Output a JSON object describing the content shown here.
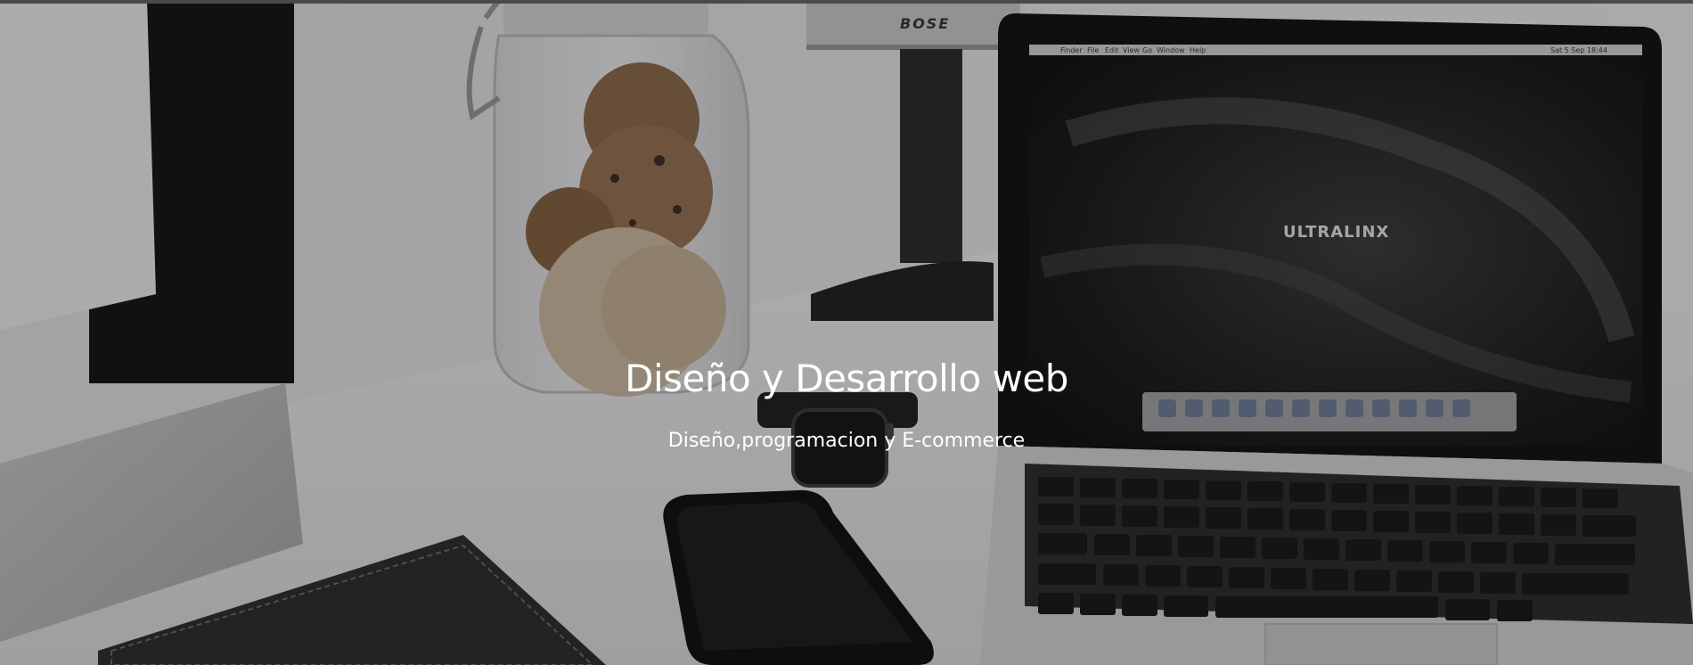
{
  "hero": {
    "title": "Diseño y Desarrollo web",
    "subtitle": "Diseño,programacion y E-commerce"
  },
  "image": {
    "laptop_screen_brand": "ULTRALINX",
    "speaker_brand": "BOSE",
    "menubar_items": [
      "Finder",
      "File",
      "Edit",
      "View",
      "Go",
      "Window",
      "Help"
    ],
    "menubar_time": "Sat 5 Sep 18:44"
  },
  "colors": {
    "overlay": "#141416",
    "title_text": "#ffffff"
  }
}
